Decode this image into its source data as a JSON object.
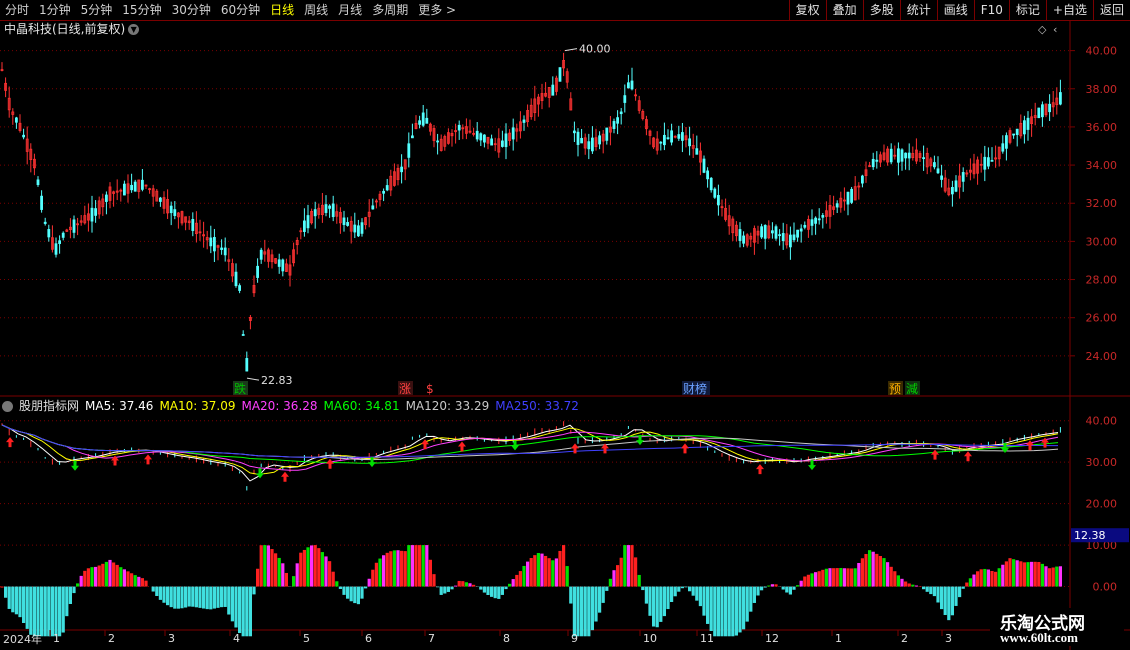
{
  "toolbar": {
    "tabs": [
      {
        "label": "分时",
        "active": false
      },
      {
        "label": "1分钟",
        "active": false
      },
      {
        "label": "5分钟",
        "active": false
      },
      {
        "label": "15分钟",
        "active": false
      },
      {
        "label": "30分钟",
        "active": false
      },
      {
        "label": "60分钟",
        "active": false
      },
      {
        "label": "日线",
        "active": true
      },
      {
        "label": "周线",
        "active": false
      },
      {
        "label": "月线",
        "active": false
      },
      {
        "label": "多周期",
        "active": false
      },
      {
        "label": "更多 >",
        "active": false
      }
    ],
    "actions": [
      "复权",
      "叠加",
      "多股",
      "统计",
      "画线",
      "F10",
      "标记",
      "+自选",
      "返回"
    ]
  },
  "stock_title": "中晶科技(日线,前复权)",
  "price_axis": [
    "40.00",
    "38.00",
    "36.00",
    "34.00",
    "32.00",
    "30.00",
    "28.00",
    "26.00",
    "24.00"
  ],
  "high_marker": "40.00",
  "low_marker": "22.83",
  "event_badges": [
    {
      "text": "跌",
      "color": "#00c000",
      "bg": "#1a3a1a"
    },
    {
      "text": "涨",
      "color": "#ff4040",
      "bg": "#3a1010"
    },
    {
      "text": "$",
      "color": "#ff4040",
      "bg": "#000000"
    },
    {
      "text": "财榜",
      "color": "#6aa0ff",
      "bg": "#101a3a"
    },
    {
      "text": "预",
      "color": "#ffb000",
      "bg": "#3a2a00"
    },
    {
      "text": "減",
      "color": "#00d000",
      "bg": "#103010"
    }
  ],
  "indicator": {
    "name": "股朋指标网",
    "ma": [
      {
        "label": "MA5: 37.46",
        "color": "#ffffff"
      },
      {
        "label": "MA10: 37.09",
        "color": "#ffff00"
      },
      {
        "label": "MA20: 36.28",
        "color": "#ff40ff"
      },
      {
        "label": "MA60: 34.81",
        "color": "#00ff00"
      },
      {
        "label": "MA120: 33.29",
        "color": "#c8c8c8"
      },
      {
        "label": "MA250: 33.72",
        "color": "#4040ff"
      }
    ],
    "axis": [
      "40.00",
      "30.00",
      "20.00",
      "10.00",
      "0.00"
    ],
    "current_value": "12.38"
  },
  "time_axis": {
    "year": "2024年",
    "months": [
      "1",
      "2",
      "3",
      "4",
      "5",
      "6",
      "7",
      "8",
      "9",
      "10",
      "11",
      "12",
      "1",
      "2",
      "3"
    ]
  },
  "watermark": {
    "title": "乐淘公式网",
    "url": "www.60lt.com"
  },
  "chart_data": {
    "type": "candlestick",
    "price_range": [
      22,
      41
    ],
    "high": 40.0,
    "low": 22.83,
    "ma_latest": {
      "MA5": 37.46,
      "MA10": 37.09,
      "MA20": 36.28,
      "MA60": 34.81,
      "MA120": 33.29,
      "MA250": 33.72
    },
    "lower_panel_range": [
      -10,
      45
    ],
    "indicator_latest": 12.38
  },
  "colors": {
    "up": "#ff3232",
    "down": "#54ffff",
    "grid": "#7a0000",
    "axis_text": "#c82828"
  }
}
